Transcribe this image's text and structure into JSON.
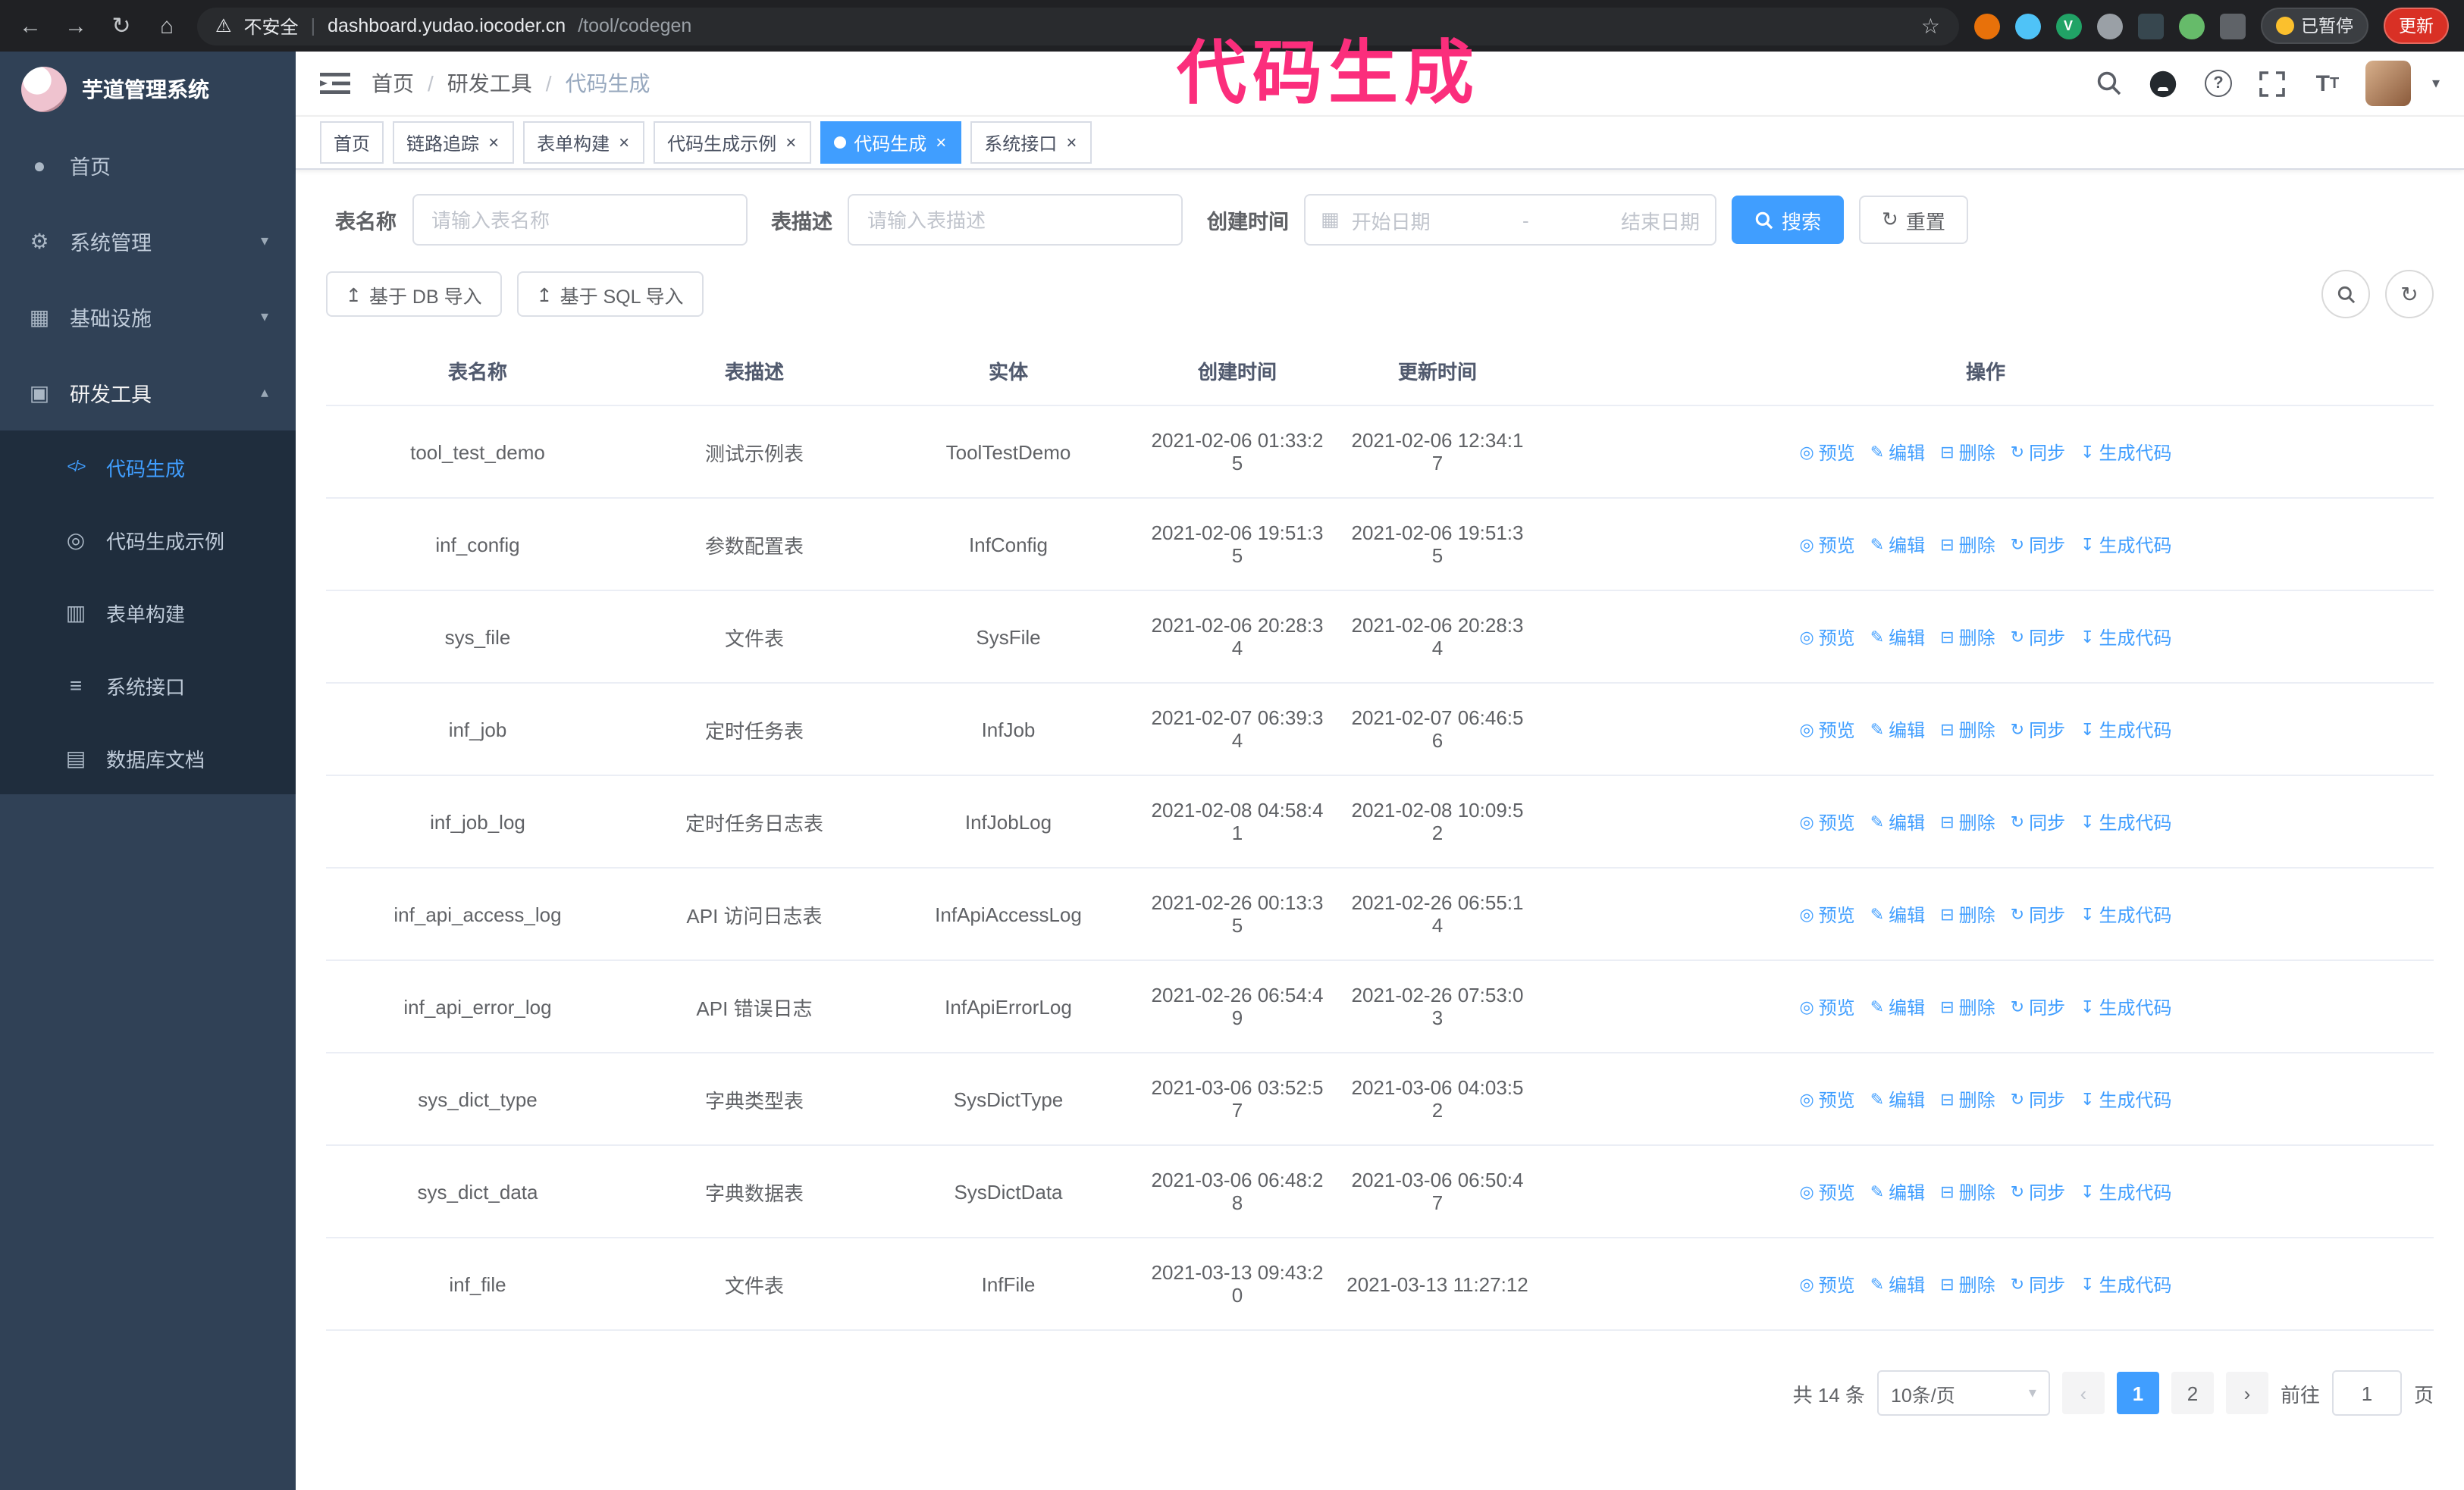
{
  "browser": {
    "security_warning": "不安全",
    "url_host": "dashboard.yudao.iocoder.cn",
    "url_path": "/tool/codegen",
    "paused_badge": "已暂停",
    "update_button": "更新"
  },
  "annotation": {
    "text": "代码生成",
    "color": "#fb2e7c"
  },
  "sidebar": {
    "logo_title": "芋道管理系统",
    "items": [
      {
        "label": "首页"
      },
      {
        "label": "系统管理"
      },
      {
        "label": "基础设施"
      },
      {
        "label": "研发工具"
      }
    ],
    "submenu": [
      {
        "label": "代码生成",
        "active": true
      },
      {
        "label": "代码生成示例"
      },
      {
        "label": "表单构建"
      },
      {
        "label": "系统接口"
      },
      {
        "label": "数据库文档"
      }
    ]
  },
  "header": {
    "breadcrumb": [
      "首页",
      "研发工具",
      "代码生成"
    ]
  },
  "tabs": [
    {
      "label": "首页"
    },
    {
      "label": "链路追踪"
    },
    {
      "label": "表单构建"
    },
    {
      "label": "代码生成示例"
    },
    {
      "label": "代码生成",
      "active": true
    },
    {
      "label": "系统接口"
    }
  ],
  "filters": {
    "table_name_label": "表名称",
    "table_name_placeholder": "请输入表名称",
    "table_desc_label": "表描述",
    "table_desc_placeholder": "请输入表描述",
    "create_time_label": "创建时间",
    "date_start_placeholder": "开始日期",
    "date_separator": "-",
    "date_end_placeholder": "结束日期",
    "search_button": "搜索",
    "reset_button": "重置"
  },
  "toolbar": {
    "import_db_button": "基于 DB 导入",
    "import_sql_button": "基于 SQL 导入"
  },
  "table": {
    "columns": [
      "表名称",
      "表描述",
      "实体",
      "创建时间",
      "更新时间",
      "操作"
    ],
    "ops": [
      "预览",
      "编辑",
      "删除",
      "同步",
      "生成代码"
    ],
    "rows": [
      [
        "tool_test_demo",
        "测试示例表",
        "ToolTestDemo",
        "2021-02-06 01:33:25",
        "2021-02-06 12:34:17"
      ],
      [
        "inf_config",
        "参数配置表",
        "InfConfig",
        "2021-02-06 19:51:35",
        "2021-02-06 19:51:35"
      ],
      [
        "sys_file",
        "文件表",
        "SysFile",
        "2021-02-06 20:28:34",
        "2021-02-06 20:28:34"
      ],
      [
        "inf_job",
        "定时任务表",
        "InfJob",
        "2021-02-07 06:39:34",
        "2021-02-07 06:46:56"
      ],
      [
        "inf_job_log",
        "定时任务日志表",
        "InfJobLog",
        "2021-02-08 04:58:41",
        "2021-02-08 10:09:52"
      ],
      [
        "inf_api_access_log",
        "API 访问日志表",
        "InfApiAccessLog",
        "2021-02-26 00:13:35",
        "2021-02-26 06:55:14"
      ],
      [
        "inf_api_error_log",
        "API 错误日志",
        "InfApiErrorLog",
        "2021-02-26 06:54:49",
        "2021-02-26 07:53:03"
      ],
      [
        "sys_dict_type",
        "字典类型表",
        "SysDictType",
        "2021-03-06 03:52:57",
        "2021-03-06 04:03:52"
      ],
      [
        "sys_dict_data",
        "字典数据表",
        "SysDictData",
        "2021-03-06 06:48:28",
        "2021-03-06 06:50:47"
      ],
      [
        "inf_file",
        "文件表",
        "InfFile",
        "2021-03-13 09:43:20",
        "2021-03-13 11:27:12"
      ]
    ]
  },
  "pagination": {
    "total": "共 14 条",
    "page_size": "10条/页",
    "pages": [
      "1",
      "2"
    ],
    "goto_label": "前往",
    "goto_value": "1",
    "page_unit": "页"
  },
  "icons": {
    "back": "←",
    "forward": "→",
    "reload": "↻",
    "home": "⌂",
    "warning": "⚠",
    "star": "☆",
    "menu_home": "●",
    "menu_system": "⚙",
    "menu_infra": "▦",
    "menu_devtools": "▣",
    "sub_codegen": "</>",
    "sub_example": "◎",
    "sub_formbuild": "▥",
    "sub_api": "≡",
    "sub_dbdoc": "▤",
    "chevron_down": "▾",
    "chevron_up": "▴",
    "calendar": "▦",
    "reset": "↻",
    "upload": "↥",
    "refresh_circle": "↻",
    "caret_down": "▾",
    "op_icons": [
      "◎",
      "✎",
      "⊟",
      "↻",
      "↧"
    ]
  },
  "colors": {
    "accent": "#409EFF",
    "annotation_pink": "#fb2e7c",
    "sidebar_bg": "#304156",
    "submenu_bg": "#1f2d3d",
    "chrome_bg": "#202124",
    "update_red": "#d93025"
  }
}
